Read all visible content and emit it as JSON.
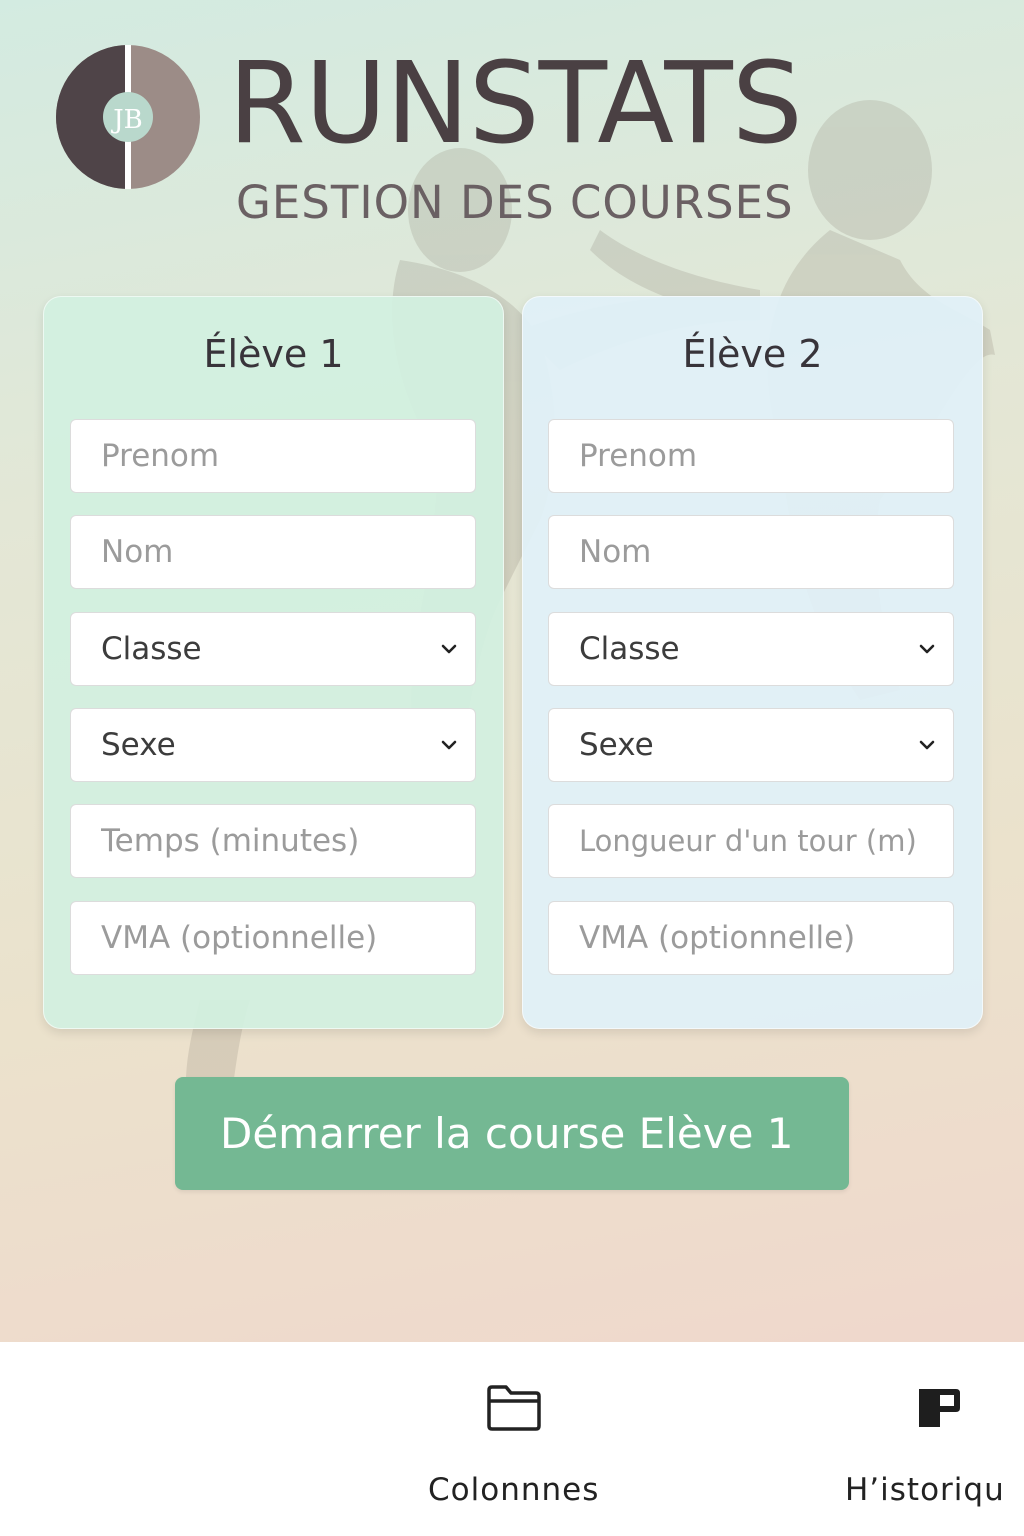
{
  "header": {
    "title": "RUNSTATS",
    "subtitle": "GESTION DES COURSES",
    "logo_initials": "JB"
  },
  "colors": {
    "card1_bg": "#d2f0e0",
    "card2_bg": "#e0f0f8",
    "start_button": "#74b893",
    "title_text": "#4a4043"
  },
  "eleve1": {
    "title": "Élève 1",
    "prenom_placeholder": "Prenom",
    "nom_placeholder": "Nom",
    "classe_label": "Classe",
    "sexe_label": "Sexe",
    "temps_placeholder": "Temps (minutes)",
    "vma_placeholder": "VMA (optionnelle)"
  },
  "eleve2": {
    "title": "Élève 2",
    "prenom_placeholder": "Prenom",
    "nom_placeholder": "Nom",
    "classe_label": "Classe",
    "sexe_label": "Sexe",
    "longueur_placeholder": "Longueur d'un tour (m)",
    "vma_placeholder": "VMA (optionnelle)"
  },
  "start_button_label": "Démarrer la course Elève 1",
  "bottom_nav": {
    "items": [
      {
        "label": "Colonnnes",
        "icon": "folder-icon"
      },
      {
        "label": "H’istoriqu",
        "icon": "history-icon"
      }
    ]
  }
}
